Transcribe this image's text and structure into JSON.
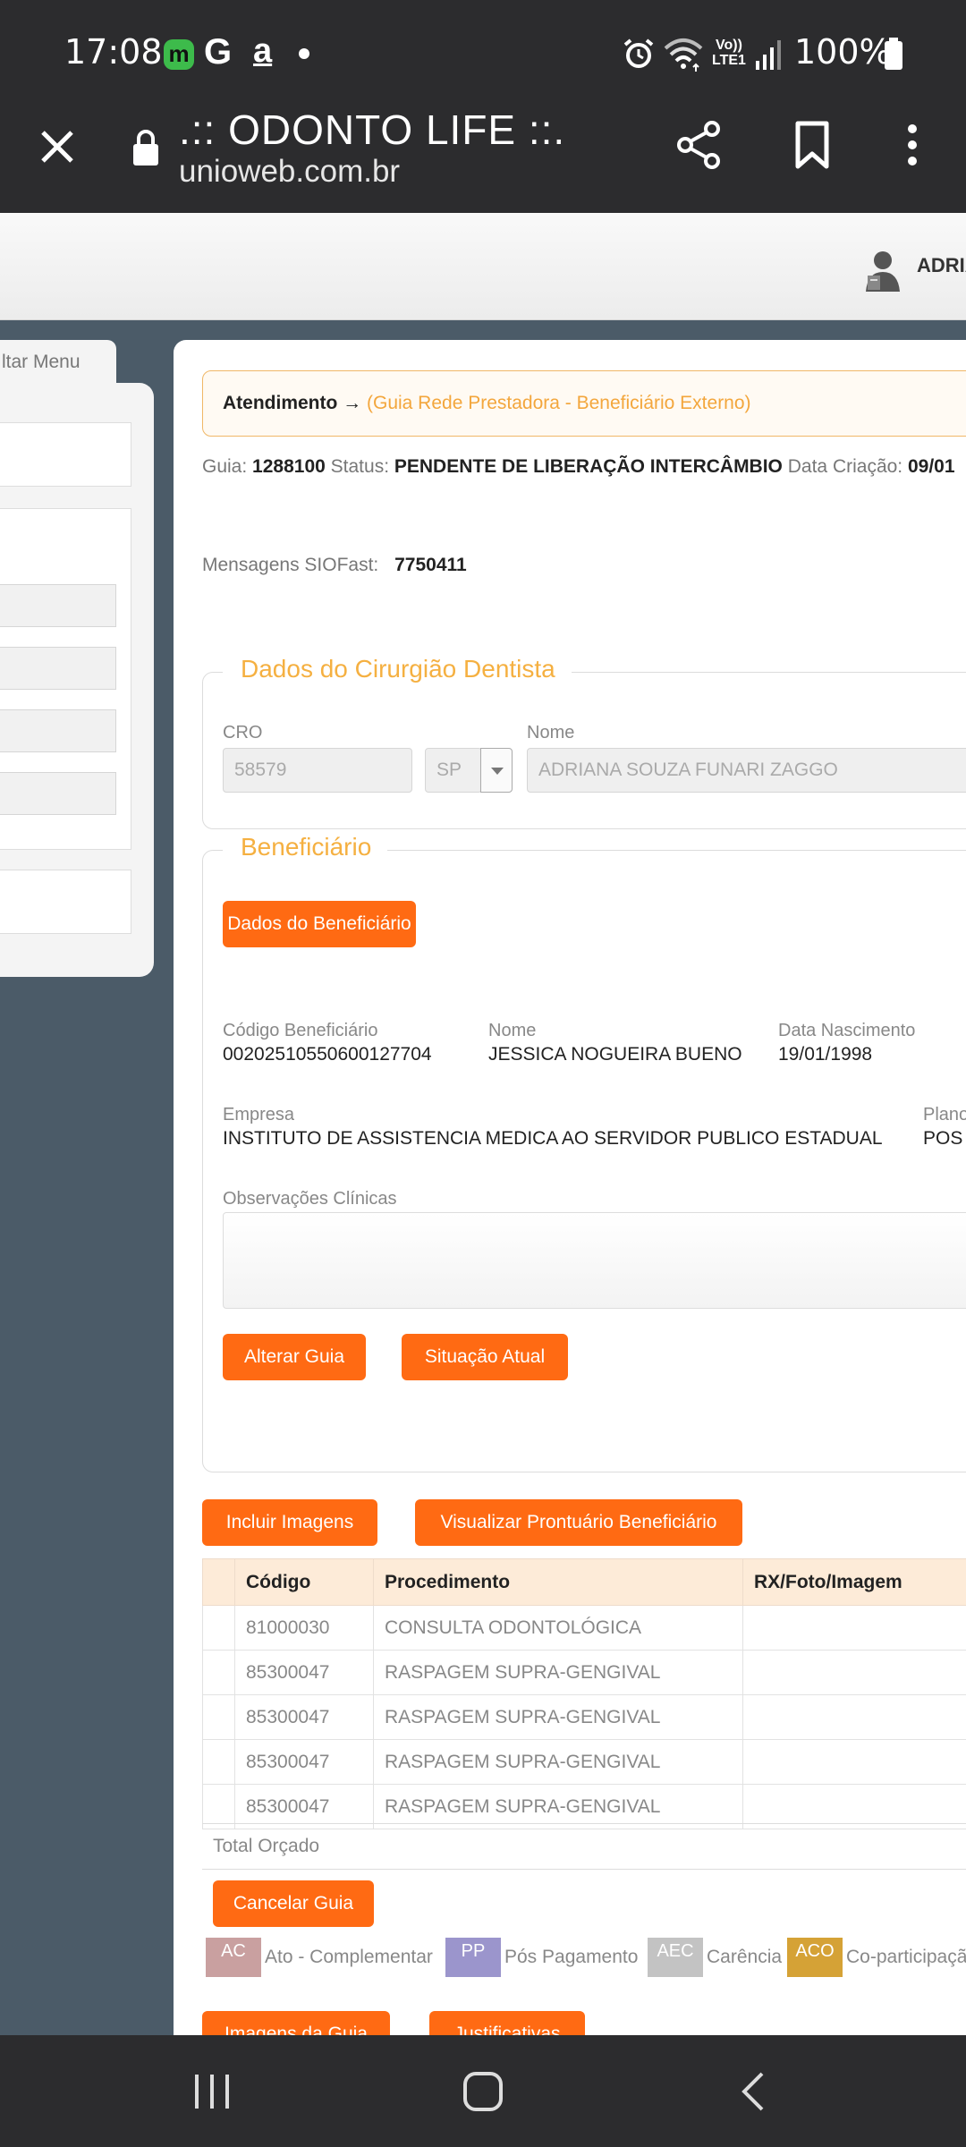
{
  "status_bar": {
    "time": "17:08",
    "notif_m": "m",
    "notif_g": "G",
    "notif_a": "a",
    "volte": "Vo))",
    "lte": "LTE1",
    "battery": "100%"
  },
  "browser": {
    "title": ".:: ODONTO LIFE ::.",
    "url": "unioweb.com.br"
  },
  "header": {
    "user_name": "ADRIA"
  },
  "sidebar": {
    "menu_label": "ltar Menu"
  },
  "breadcrumb": {
    "main": "Atendimento",
    "arrow": " → ",
    "sub": "(Guia Rede Prestadora - Beneficiário Externo)"
  },
  "guide": {
    "guia_label": "Guia:",
    "guia_value": "1288100",
    "status_label": "Status:",
    "status_value": "PENDENTE DE LIBERAÇÃO INTERCÂMBIO",
    "date_label": "Data Criação:",
    "date_value": "09/01"
  },
  "messages": {
    "label": "Mensagens SIOFast:",
    "value": "7750411"
  },
  "dentist": {
    "legend": "Dados do Cirurgião Dentista",
    "cro_label": "CRO",
    "cro_value": "58579",
    "uf_value": "SP",
    "name_label": "Nome",
    "name_value": "ADRIANA SOUZA FUNARI ZAGGO"
  },
  "beneficiary": {
    "legend": "Beneficiário",
    "data_button": "Dados do Beneficiário",
    "code_label": "Código Beneficiário",
    "code_value": "00202510550600127704",
    "name_label": "Nome",
    "name_value": "JESSICA NOGUEIRA BUENO",
    "birth_label": "Data Nascimento",
    "birth_value": "19/01/1998",
    "company_label": "Empresa",
    "company_value": "INSTITUTO DE ASSISTENCIA MEDICA AO SERVIDOR PUBLICO ESTADUAL",
    "plan_label": "Plano",
    "plan_value": "POS",
    "obs_label": "Observações Clínicas",
    "alter_button": "Alterar Guia",
    "situation_button": "Situação Atual"
  },
  "actions": {
    "include_images": "Incluir Imagens",
    "view_records": "Visualizar Prontuário Beneficiário",
    "cancel_guide": "Cancelar Guia",
    "guide_images": "Imagens da Guia",
    "justifications": "Justificativas"
  },
  "table": {
    "headers": [
      "Código",
      "Procedimento",
      "RX/Foto/Imagem"
    ],
    "rows": [
      [
        "81000030",
        "CONSULTA ODONTOLÓGICA",
        ""
      ],
      [
        "85300047",
        "RASPAGEM SUPRA-GENGIVAL",
        ""
      ],
      [
        "85300047",
        "RASPAGEM SUPRA-GENGIVAL",
        ""
      ],
      [
        "85300047",
        "RASPAGEM SUPRA-GENGIVAL",
        ""
      ],
      [
        "85300047",
        "RASPAGEM SUPRA-GENGIVAL",
        ""
      ]
    ],
    "total_label": "Total Orçado"
  },
  "legend": [
    {
      "code": "AC",
      "label": "Ato - Complementar",
      "color": "#c9a0a0"
    },
    {
      "code": "PP",
      "label": "Pós Pagamento",
      "color": "#9b95cc"
    },
    {
      "code": "AEC",
      "label": "Carência",
      "color": "#c3c3c3"
    },
    {
      "code": "ACO",
      "label": "Co-participação",
      "color": "#d5a236"
    }
  ],
  "colors": {
    "accent": "#ff6a13",
    "legend_text": "#f5b041",
    "dark_bar": "#2c2c2e"
  }
}
